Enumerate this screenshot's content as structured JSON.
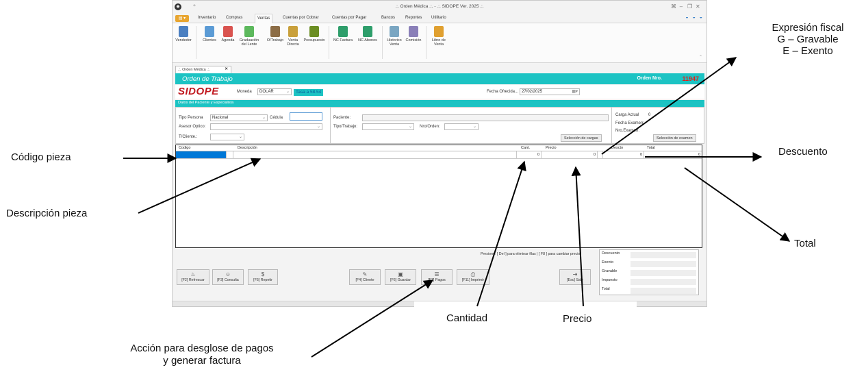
{
  "window": {
    "title": ".:. Orden Médica .:. - .:. SIDOPE Ver. 2025 .:.",
    "controls": [
      "⌘",
      "–",
      "❐",
      "✕"
    ],
    "qat": "÷"
  },
  "menu": {
    "file_label": "▤ ▾",
    "items": [
      "Inventario",
      "Compras",
      "Ventas",
      "Cuentas por Cobrar",
      "Cuentas por Pagar",
      "Bancos",
      "Reportes",
      "Utilitario"
    ],
    "active": "Ventas",
    "help_icons": "◒ ◒ ◒"
  },
  "ribbon": {
    "buttons": [
      {
        "label": "Vendedor",
        "icon": "person-icon",
        "color": "#4a7fc1"
      },
      {
        "label": "Clientes",
        "icon": "clients-icon",
        "color": "#5b9bd5"
      },
      {
        "label": "Agenda",
        "icon": "calendar-icon",
        "color": "#d9534f"
      },
      {
        "label": "Graduación del Lente",
        "icon": "lens-icon",
        "color": "#5cb85c"
      },
      {
        "label": "O/Trabajo",
        "icon": "work-order-icon",
        "color": "#8c6d46"
      },
      {
        "label": "Venta Directa",
        "icon": "sale-icon",
        "color": "#c9a03b"
      },
      {
        "label": "Presupuesto",
        "icon": "budget-icon",
        "color": "#6b8e23"
      },
      {
        "label": "NC Factura",
        "icon": "credit-note-icon",
        "color": "#2e9e6b"
      },
      {
        "label": "NC Abonos",
        "icon": "credit-payment-icon",
        "color": "#2e9e6b"
      },
      {
        "label": "Historico Venta",
        "icon": "history-icon",
        "color": "#7aa6c2"
      },
      {
        "label": "Comisión",
        "icon": "commission-icon",
        "color": "#8a7fb8"
      },
      {
        "label": "Libro de Venta",
        "icon": "book-icon",
        "color": "#e0a030"
      }
    ]
  },
  "doc_tab": {
    "label": ".:. Orden Médica .:.",
    "close": "✕"
  },
  "form": {
    "title": "Orden de Trabajo",
    "orden_label": "Orden Nro.",
    "orden_number": "11947",
    "logo": "SIDOPE",
    "moneda_label": "Moneda",
    "moneda_value": "DOLAR",
    "tasa": "Tasa a 58.54",
    "fecha_label": "Fecha Ofrecida...",
    "fecha_value": "27/02/2025",
    "section_title": "Datos del Paciente y Especialista",
    "tipo_persona_label": "Tipo Persona",
    "tipo_persona_value": "Nacional",
    "cedula_label": "Cédula",
    "asesor_label": "Asesor Optico:",
    "tcliente_label": "T/Cliente.:",
    "paciente_label": "Paciente:",
    "tipo_trabajo_label": "Tipo/Trabajo:",
    "nro_orden_label": "Nro/Orden:",
    "seleccion_cargas": "Selección de cargas",
    "carga_actual_label": "Carga Actual",
    "carga_actual_value": "0",
    "fecha_examen_label": "Fecha Examen:",
    "nro_examen_label": "Nro.Examen:",
    "seleccion_examen": "Selección de examen"
  },
  "grid": {
    "columns": [
      "Codigo",
      "Descripción",
      "Cant.",
      "Precio",
      "Descto",
      "Total"
    ],
    "row": {
      "cant": "0",
      "precio": "0",
      "descto": "0",
      "total": "0"
    }
  },
  "hint": "Presione: [ Del ] para eliminar filas | [ F8 ] para cambiar precio",
  "bottom_buttons": [
    {
      "label": "[F2] Refrescar",
      "glyph": "♨"
    },
    {
      "label": "[F3] Consulta",
      "glyph": "☺"
    },
    {
      "label": "[F5] Repetir",
      "glyph": "$"
    },
    {
      "label": "[F4] Cliente",
      "glyph": "✎"
    },
    {
      "label": "[F6] Guardar",
      "glyph": "▣"
    },
    {
      "label": "[F7] Pagos",
      "glyph": "☰"
    },
    {
      "label": "[F11] Imprimir",
      "glyph": "⎙"
    },
    {
      "label": "[Esc] Salir",
      "glyph": "⇥"
    }
  ],
  "summary": [
    "Descuento",
    "Exento",
    "Gravable",
    "Impuesto",
    "Total"
  ],
  "annotations": {
    "codigo": "Código pieza",
    "descripcion": "Descripción pieza",
    "cantidad": "Cantidad",
    "precio": "Precio",
    "expresion_1": "Expresión fiscal",
    "expresion_2": "G – Gravable",
    "expresion_3": "E – Exento",
    "descuento": "Descuento",
    "total": "Total",
    "accion_1": "Acción para desglose de pagos",
    "accion_2": "y generar factura"
  }
}
